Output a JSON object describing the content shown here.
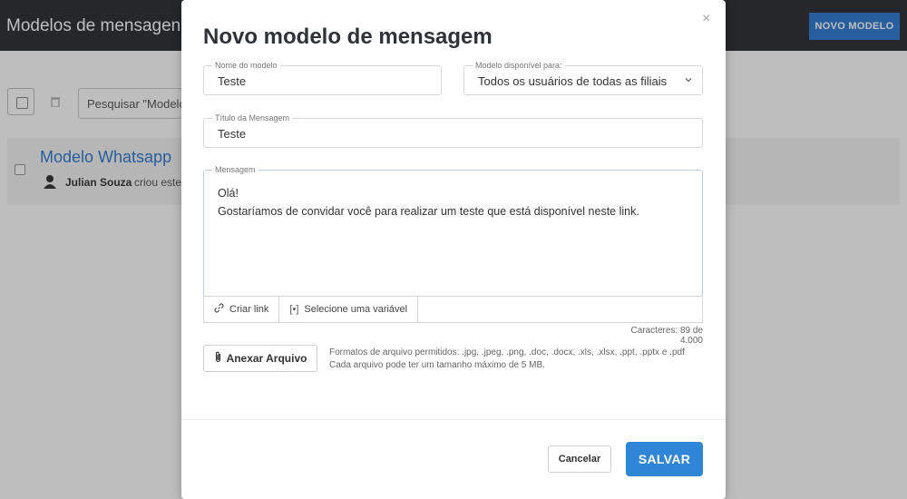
{
  "background": {
    "page_title": "Modelos de mensagens",
    "new_button_label": "NOVO MODELO",
    "search_placeholder": "Pesquisar \"Modelos",
    "card": {
      "title": "Modelo Whatsapp",
      "user": "Julian Souza",
      "action": "criou este"
    }
  },
  "modal": {
    "title": "Novo modelo de mensagem",
    "close_label": "×",
    "fields": {
      "model_name": {
        "label": "Nome do modelo",
        "value": "Teste"
      },
      "available_for": {
        "label": "Modelo disponível para:",
        "value": "Todos os usuários de todas as filiais"
      },
      "message_title": {
        "label": "Título da Mensagem",
        "value": "Teste"
      },
      "message": {
        "label": "Mensagem",
        "lines": [
          "Olá!",
          "Gostaríamos de convidar você para realizar um teste que está disponível neste link."
        ]
      }
    },
    "toolbar": {
      "create_link": "Criar link",
      "select_variable": "Selecione uma variável",
      "variable_icon_text": "[•]"
    },
    "char_count": "Caracteres: 89 de 4.000",
    "attach": {
      "label": "Anexar Arquivo",
      "help_line1": "Formatos de arquivo permitidos: .jpg, .jpeg, .png, .doc, .docx, .xls, .xlsx, .ppt, .pptx e .pdf",
      "help_line2": "Cada arquivo pode ter um tamanho máximo de 5 MB."
    },
    "buttons": {
      "cancel": "Cancelar",
      "save": "SALVAR"
    }
  },
  "colors": {
    "primary": "#2f86d6",
    "topbar": "#2c2f33",
    "link": "#2e7bd1"
  }
}
